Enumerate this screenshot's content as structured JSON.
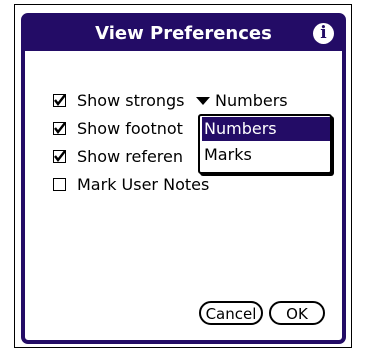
{
  "dialog": {
    "title": "View Preferences",
    "title_bar_color": "#230c66",
    "info_icon": "info-icon"
  },
  "options": [
    {
      "label": "Show strongs",
      "checked": true
    },
    {
      "label": "Show footnot",
      "checked": true
    },
    {
      "label": "Show referen",
      "checked": true
    },
    {
      "label": "Mark User Notes",
      "checked": false
    }
  ],
  "strongs_format": {
    "selected": "Numbers",
    "trigger_icon": "triangle-down-icon",
    "options": [
      "Numbers",
      "Marks"
    ],
    "highlighted": "Numbers"
  },
  "buttons": {
    "cancel": "Cancel",
    "ok": "OK"
  }
}
